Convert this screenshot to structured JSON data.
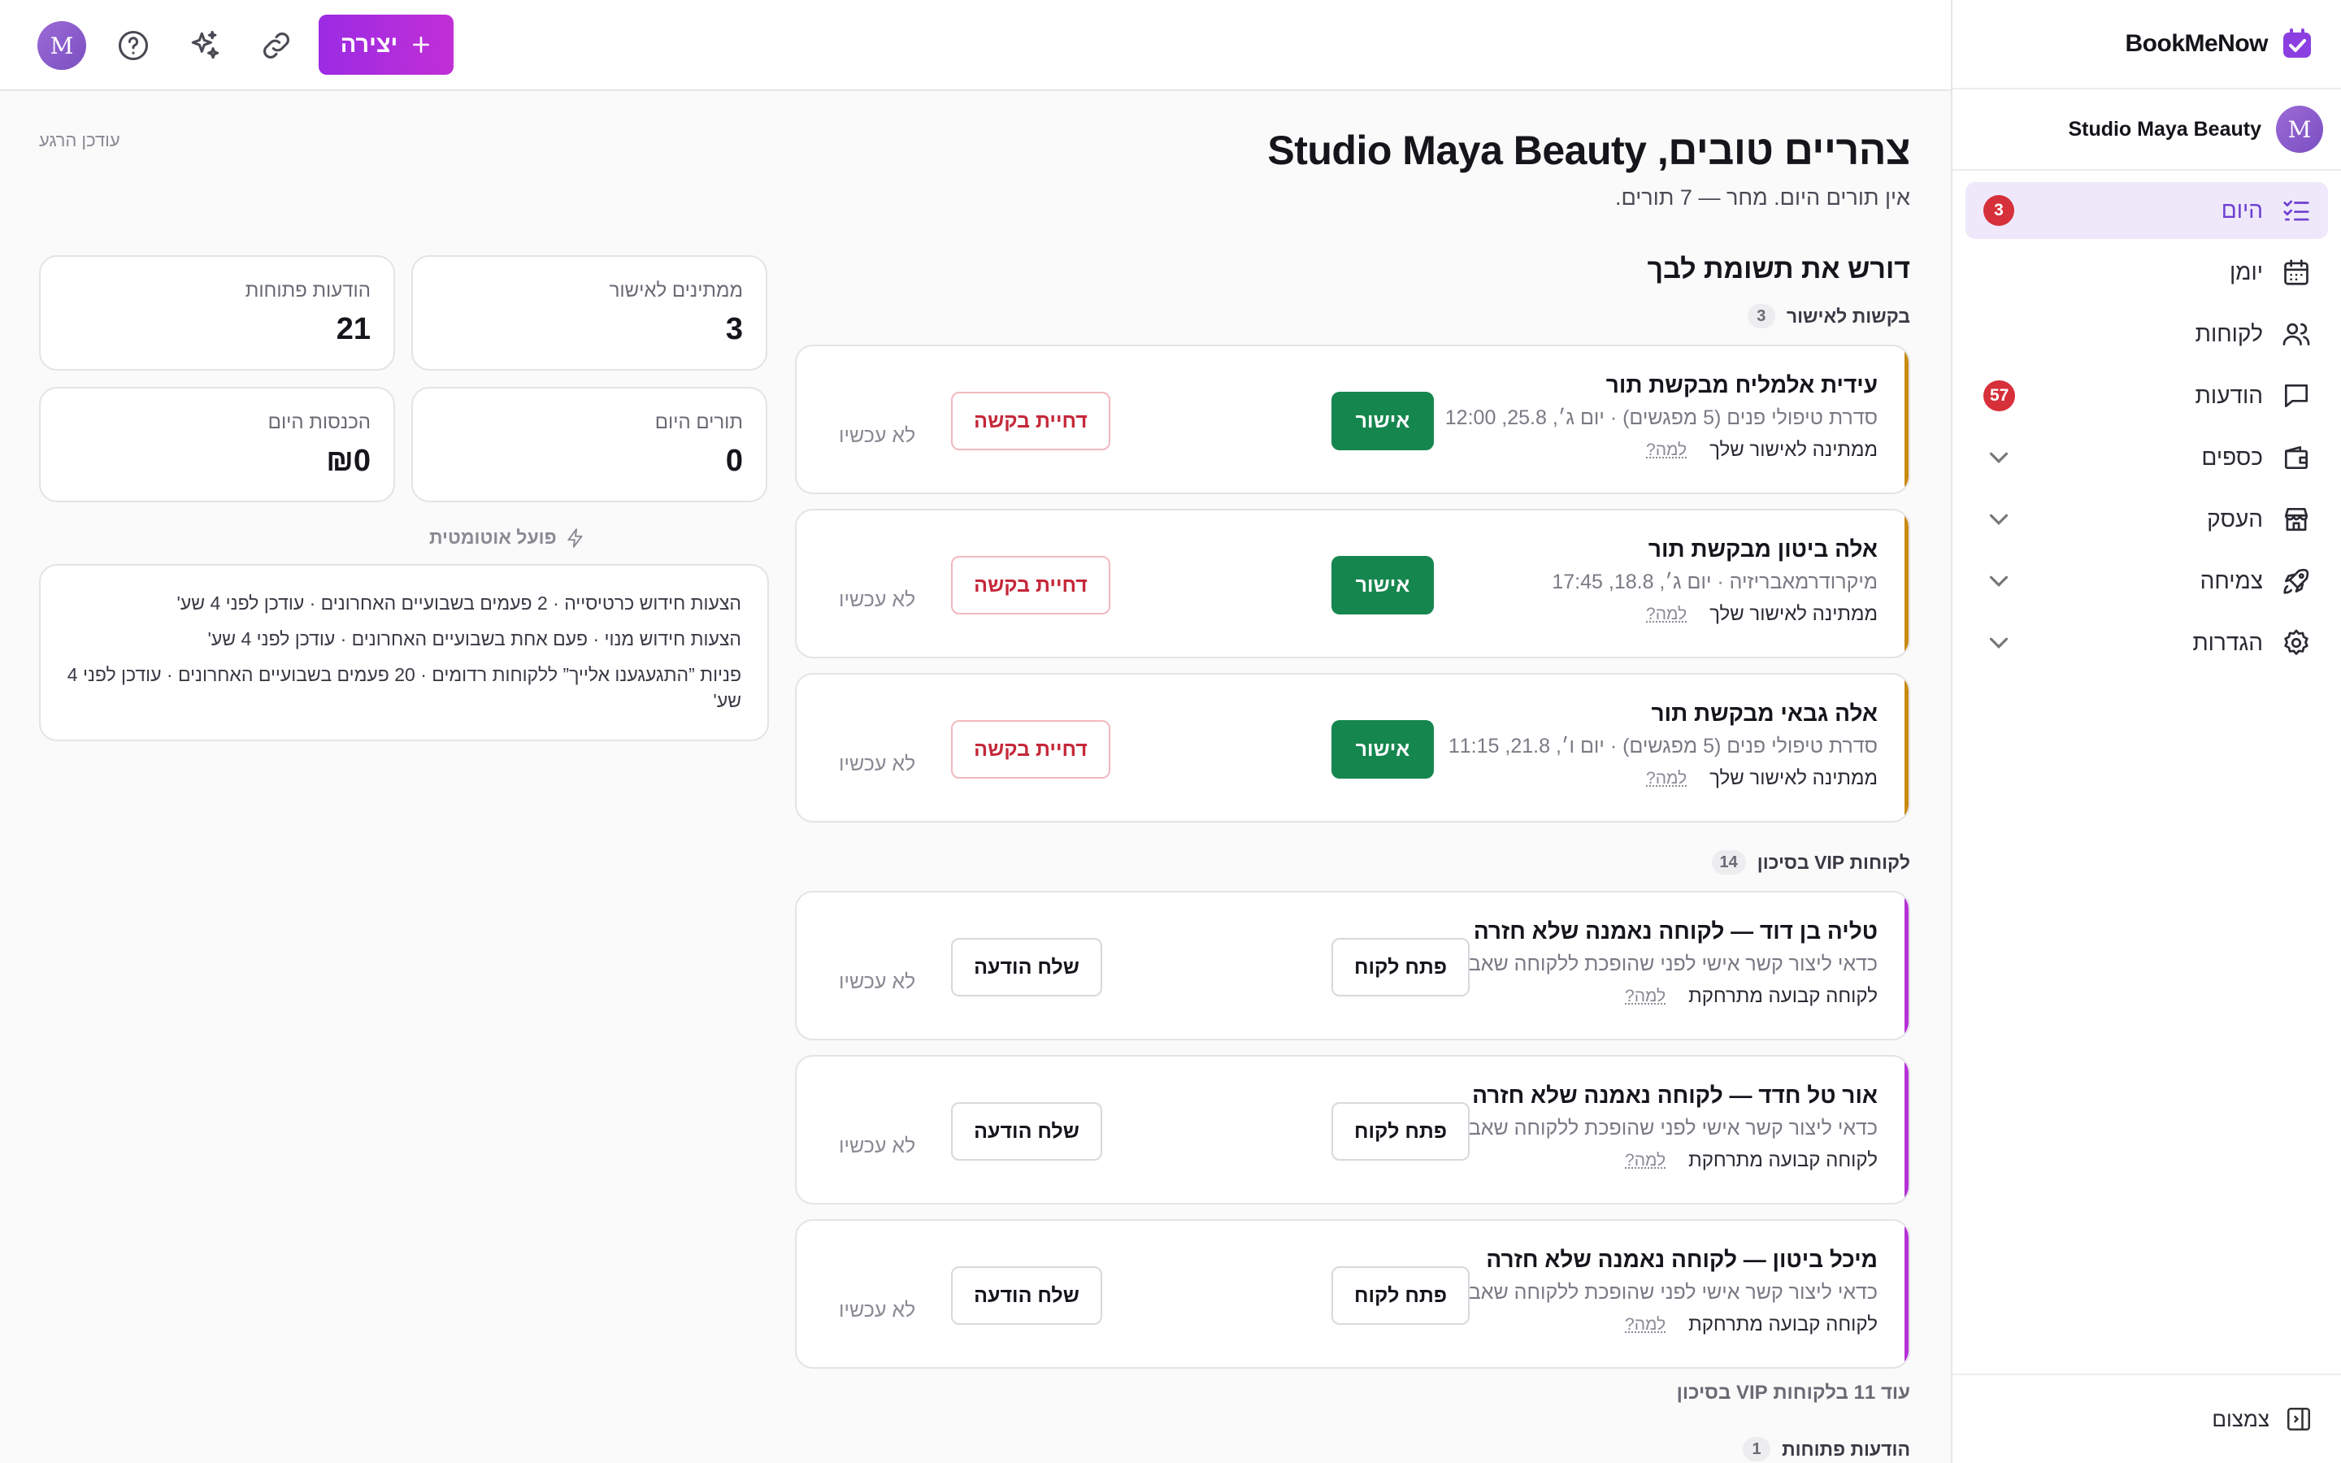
{
  "brand": {
    "name": "BookMeNow"
  },
  "org": {
    "avatar_letter": "M",
    "name": "Studio Maya Beauty"
  },
  "nav": [
    {
      "label": "היום",
      "badge": "3",
      "active": true,
      "icon": "checklist-icon"
    },
    {
      "label": "יומן",
      "icon": "calendar-icon"
    },
    {
      "label": "לקוחות",
      "icon": "users-icon"
    },
    {
      "label": "הודעות",
      "badge": "57",
      "icon": "chat-icon"
    },
    {
      "label": "כספים",
      "icon": "wallet-icon",
      "expandable": true
    },
    {
      "label": "העסק",
      "icon": "store-icon",
      "expandable": true
    },
    {
      "label": "צמיחה",
      "icon": "rocket-icon",
      "expandable": true
    },
    {
      "label": "הגדרות",
      "icon": "gear-icon",
      "expandable": true
    }
  ],
  "collapse_label": "צמצום",
  "topbar": {
    "create_label": "יצירה",
    "user_avatar_letter": "M"
  },
  "main": {
    "greeting": "צהריים טובים, Studio Maya Beauty",
    "subtitle": "אין תורים היום. מחר — 7 תורים.",
    "updated": "עודכן הרגע",
    "attention_title": "דורש את תשומת לבך",
    "groups": {
      "requests": {
        "label": "בקשות לאישור",
        "count": "3"
      },
      "vip": {
        "label": "לקוחות VIP בסיכון",
        "count": "14"
      },
      "more_vip": "עוד 11 בלקוחות VIP בסיכון",
      "messages": {
        "label": "הודעות פתוחות",
        "count": "1"
      }
    },
    "requests": [
      {
        "title": "עידית אלמליח מבקשת תור",
        "subtitle": "סדרת טיפולי פנים (5 מפגשים) · יום ג׳, 25.8, 12:00",
        "status": "ממתינה לאישור שלך",
        "why": "למה?",
        "approve": "אישור",
        "reject": "דחיית בקשה",
        "later": "לא עכשיו"
      },
      {
        "title": "אלה ביטון מבקשת תור",
        "subtitle": "מיקרודרמאבריזיה · יום ג׳, 18.8, 17:45",
        "status": "ממתינה לאישור שלך",
        "why": "למה?",
        "approve": "אישור",
        "reject": "דחיית בקשה",
        "later": "לא עכשיו"
      },
      {
        "title": "אלה גבאי מבקשת תור",
        "subtitle": "סדרת טיפולי פנים (5 מפגשים) · יום ו׳, 21.8, 11:15",
        "status": "ממתינה לאישור שלך",
        "why": "למה?",
        "approve": "אישור",
        "reject": "דחיית בקשה",
        "later": "לא עכשיו"
      }
    ],
    "vip": [
      {
        "title": "טליה בן דוד — לקוחה נאמנה שלא חזרה",
        "subtitle": "כדאי ליצור קשר אישי לפני שהופכת ללקוחה שאבדה.",
        "status": "לקוחה קבועה מתרחקת",
        "why": "למה?",
        "open": "פתח לקוח",
        "message": "שלח הודעה",
        "later": "לא עכשיו"
      },
      {
        "title": "אור טל חדד — לקוחה נאמנה שלא חזרה",
        "subtitle": "כדאי ליצור קשר אישי לפני שהופכת ללקוחה שאבדה.",
        "status": "לקוחה קבועה מתרחקת",
        "why": "למה?",
        "open": "פתח לקוח",
        "message": "שלח הודעה",
        "later": "לא עכשיו"
      },
      {
        "title": "מיכל ביטון — לקוחה נאמנה שלא חזרה",
        "subtitle": "כדאי ליצור קשר אישי לפני שהופכת ללקוחה שאבדה.",
        "status": "לקוחה קבועה מתרחקת",
        "why": "למה?",
        "open": "פתח לקוח",
        "message": "שלח הודעה",
        "later": "לא עכשיו"
      }
    ],
    "stats": [
      {
        "label": "ממתינים לאישור",
        "value": "3"
      },
      {
        "label": "הודעות פתוחות",
        "value": "21"
      },
      {
        "label": "תורים היום",
        "value": "0"
      },
      {
        "label": "הכנסות היום",
        "value": "₪0"
      }
    ],
    "automation": {
      "title": "פועל אוטומטית",
      "lines": [
        "הצעות חידוש כרטיסייה · 2 פעמים בשבועיים האחרונים · עודכן לפני 4 שע'",
        "הצעות חידוש מנוי · פעם אחת בשבועיים האחרונים · עודכן לפני 4 שע'",
        "פניות ”התגעגענו אלייך” ללקוחות רדומים · 20 פעמים בשבועיים האחרונים · עודכן לפני 4 שע'"
      ]
    }
  },
  "colors": {
    "accent": "#6d3fcf",
    "create_gradient_start": "#9b2be3",
    "approve": "#16864f",
    "reject": "#c5283a",
    "badge": "#d6303a",
    "pending_stripe": "#c98a12",
    "vip_stripe": "#b532d6"
  }
}
